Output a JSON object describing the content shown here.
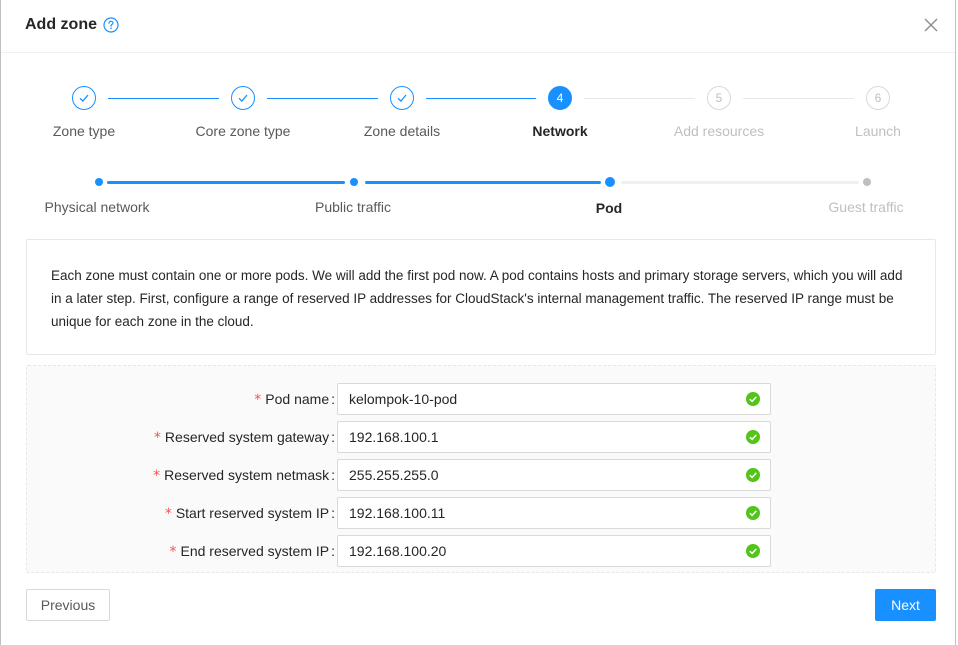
{
  "header": {
    "title": "Add zone"
  },
  "steps": [
    {
      "number": "1",
      "label": "Zone type",
      "status": "done"
    },
    {
      "number": "2",
      "label": "Core zone type",
      "status": "done"
    },
    {
      "number": "3",
      "label": "Zone details",
      "status": "done"
    },
    {
      "number": "4",
      "label": "Network",
      "status": "active"
    },
    {
      "number": "5",
      "label": "Add resources",
      "status": "wait"
    },
    {
      "number": "6",
      "label": "Launch",
      "status": "wait"
    }
  ],
  "substeps": [
    {
      "label": "Physical network",
      "status": "done"
    },
    {
      "label": "Public traffic",
      "status": "done"
    },
    {
      "label": "Pod",
      "status": "active"
    },
    {
      "label": "Guest traffic",
      "status": "wait"
    }
  ],
  "description": "Each zone must contain one or more pods. We will add the first pod now. A pod contains hosts and primary storage servers, which you will add in a later step. First, configure a range of reserved IP addresses for CloudStack's internal management traffic. The reserved IP range must be unique for each zone in the cloud.",
  "form": {
    "fields": [
      {
        "label": "Pod name",
        "value": "kelompok-10-pod"
      },
      {
        "label": "Reserved system gateway",
        "value": "192.168.100.1"
      },
      {
        "label": "Reserved system netmask",
        "value": "255.255.255.0"
      },
      {
        "label": "Start reserved system IP",
        "value": "192.168.100.11"
      },
      {
        "label": "End reserved system IP",
        "value": "192.168.100.20"
      }
    ]
  },
  "buttons": {
    "previous": "Previous",
    "next": "Next"
  },
  "colors": {
    "primary": "#1890ff",
    "success": "#52c41a",
    "required": "#ff4d4f"
  }
}
